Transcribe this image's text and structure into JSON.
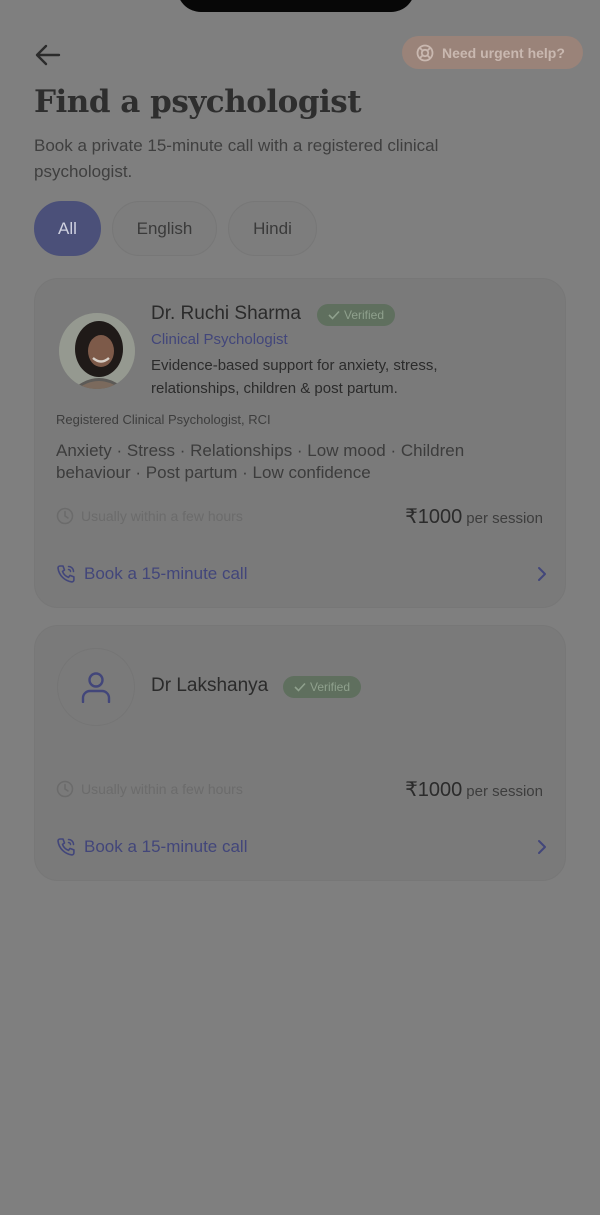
{
  "header": {
    "urgent_help_label": "Need urgent help?",
    "title": "Find a psychologist",
    "subtitle": "Book a private 15-minute call with a registered clinical psychologist."
  },
  "filters": [
    {
      "label": "All",
      "active": true
    },
    {
      "label": "English",
      "active": false
    },
    {
      "label": "Hindi",
      "active": false
    }
  ],
  "psychologists": [
    {
      "name": "Dr. Ruchi Sharma",
      "verified_label": "Verified",
      "role": "Clinical Psychologist",
      "blurb": "Evidence-based support for anxiety, stress, relationships, children & post partum.",
      "registration": "Registered Clinical Psychologist, RCI",
      "tags": "Anxiety · Stress · Relationships · Low mood · Children behaviour · Post partum · Low confidence",
      "availability": "Usually within a few hours",
      "price": "₹1000",
      "price_unit": "per session",
      "book_label": "Book a 15-minute call"
    },
    {
      "name": "Dr Lakshanya",
      "verified_label": "Verified",
      "availability": "Usually within a few hours",
      "price": "₹1000",
      "price_unit": "per session",
      "book_label": "Book a 15-minute call"
    }
  ],
  "colors": {
    "overlay_bg": "#7f7f7f",
    "accent": "#4b5079",
    "verified_badge": "#5f6f5e",
    "urgent_button": "#9a8379"
  }
}
